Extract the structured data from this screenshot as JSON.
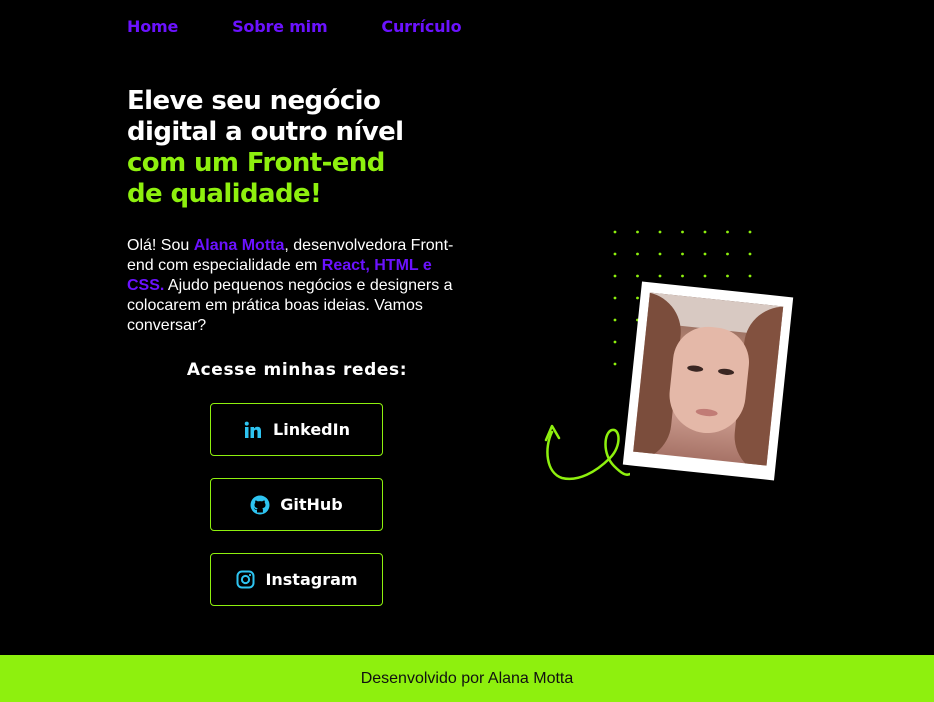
{
  "nav": {
    "items": [
      {
        "label": "Home"
      },
      {
        "label": "Sobre mim"
      },
      {
        "label": "Currículo"
      }
    ]
  },
  "hero": {
    "line1": "Eleve seu negócio",
    "line2": "digital a outro nível",
    "line3": "com um Front-end",
    "line4": "de qualidade!"
  },
  "intro": {
    "p1": "Olá! Sou ",
    "name": "Alana Motta",
    "p2": ", desenvolvedora Front-end com especialidade em ",
    "skills": "React, HTML e CSS.",
    "p3": " Ajudo pequenos negócios e designers a colocarem em prática boas ideias. Vamos conversar?"
  },
  "social": {
    "title": "Acesse minhas redes:",
    "buttons": [
      {
        "label": "LinkedIn",
        "icon": "linkedin-icon"
      },
      {
        "label": "GitHub",
        "icon": "github-icon"
      },
      {
        "label": "Instagram",
        "icon": "instagram-icon"
      }
    ]
  },
  "colors": {
    "accent_green": "#8ef00e",
    "accent_purple": "#6b12ff",
    "icon_blue": "#2ec4f1",
    "background": "#000000"
  },
  "footer": {
    "text": "Desenvolvido por Alana Motta"
  }
}
